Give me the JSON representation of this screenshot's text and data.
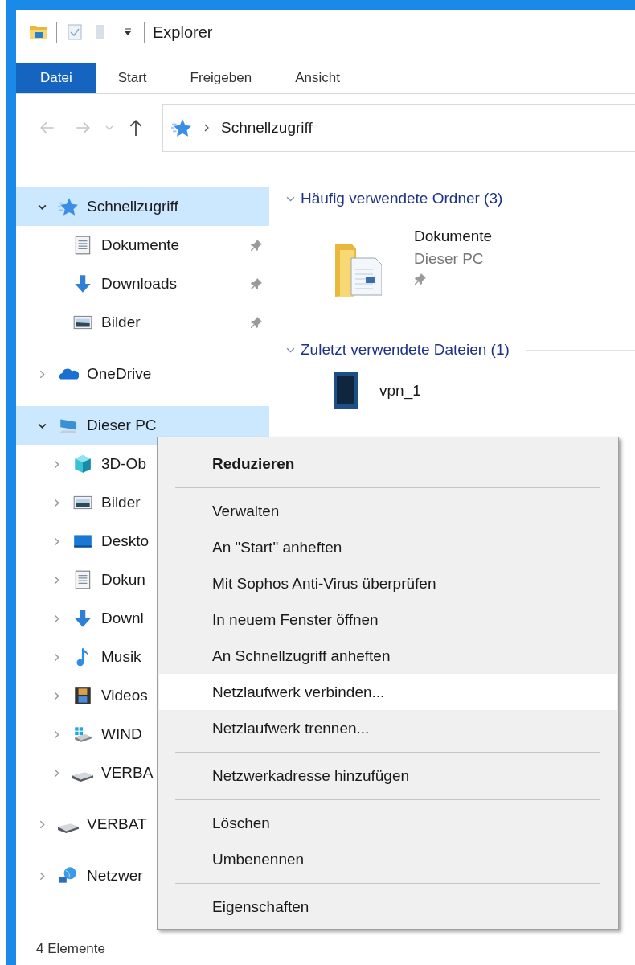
{
  "window": {
    "title": "Explorer"
  },
  "ribbon_tabs": [
    {
      "label": "Datei",
      "kind": "file"
    },
    {
      "label": "Start",
      "kind": "tab"
    },
    {
      "label": "Freigeben",
      "kind": "tab"
    },
    {
      "label": "Ansicht",
      "kind": "tab"
    }
  ],
  "address": {
    "path": [
      "Schnellzugriff"
    ]
  },
  "nav_tree": [
    {
      "label": "Schnellzugriff",
      "kind": "star",
      "expanded": true,
      "selected": true,
      "children": [
        {
          "label": "Dokumente",
          "kind": "document",
          "pinned": true,
          "selected": false
        },
        {
          "label": "Downloads",
          "kind": "download",
          "pinned": true,
          "selected": false
        },
        {
          "label": "Bilder",
          "kind": "pictures",
          "pinned": true,
          "selected": false
        }
      ]
    },
    {
      "label": "OneDrive",
      "kind": "cloud",
      "expanded": false,
      "selected": false
    },
    {
      "label": "Dieser PC",
      "kind": "pc",
      "expanded": true,
      "selected": true,
      "children": [
        {
          "label": "3D-Ob",
          "kind": "cube",
          "expanded": false,
          "selected": false
        },
        {
          "label": "Bilder",
          "kind": "pictures",
          "expanded": false,
          "selected": false
        },
        {
          "label": "Deskto",
          "kind": "desktop",
          "expanded": false,
          "selected": false
        },
        {
          "label": "Dokun",
          "kind": "document",
          "expanded": false,
          "selected": false
        },
        {
          "label": "Downl",
          "kind": "download",
          "expanded": false,
          "selected": false
        },
        {
          "label": "Musik",
          "kind": "music",
          "expanded": false,
          "selected": false
        },
        {
          "label": "Videos",
          "kind": "video",
          "expanded": false,
          "selected": false
        },
        {
          "label": "WIND",
          "kind": "windrive",
          "expanded": false,
          "selected": false
        },
        {
          "label": "VERBA",
          "kind": "drive",
          "expanded": false,
          "selected": false
        }
      ]
    },
    {
      "label": "VERBAT",
      "kind": "drive",
      "expanded": false,
      "selected": false
    },
    {
      "label": "Netzwer",
      "kind": "network",
      "expanded": false,
      "selected": false
    }
  ],
  "content_groups": [
    {
      "title": "Häufig verwendete Ordner (3)",
      "expanded": true,
      "items": [
        {
          "kind": "folder",
          "name": "Dokumente",
          "location": "Dieser PC",
          "pinned": true
        }
      ]
    },
    {
      "title": "Zuletzt verwendete Dateien (1)",
      "expanded": true,
      "items": [
        {
          "kind": "file",
          "name": "vpn_1"
        }
      ]
    }
  ],
  "context_menu": {
    "groups": [
      {
        "items": [
          {
            "label": "Reduzieren",
            "default": true,
            "highlighted": false
          }
        ]
      },
      {
        "items": [
          {
            "label": "Verwalten",
            "default": false,
            "highlighted": false
          },
          {
            "label": "An \"Start\" anheften",
            "default": false,
            "highlighted": false
          },
          {
            "label": "Mit Sophos Anti-Virus überprüfen",
            "default": false,
            "highlighted": false
          },
          {
            "label": "In neuem Fenster öffnen",
            "default": false,
            "highlighted": false
          },
          {
            "label": "An Schnellzugriff anheften",
            "default": false,
            "highlighted": false
          },
          {
            "label": "Netzlaufwerk verbinden...",
            "default": false,
            "highlighted": true
          },
          {
            "label": "Netzlaufwerk trennen...",
            "default": false,
            "highlighted": false
          }
        ]
      },
      {
        "items": [
          {
            "label": "Netzwerkadresse hinzufügen",
            "default": false,
            "highlighted": false
          }
        ]
      },
      {
        "items": [
          {
            "label": "Löschen",
            "default": false,
            "highlighted": false
          },
          {
            "label": "Umbenennen",
            "default": false,
            "highlighted": false
          }
        ]
      },
      {
        "items": [
          {
            "label": "Eigenschaften",
            "default": false,
            "highlighted": false
          }
        ]
      }
    ]
  },
  "status_bar": {
    "text": "4 Elemente"
  }
}
